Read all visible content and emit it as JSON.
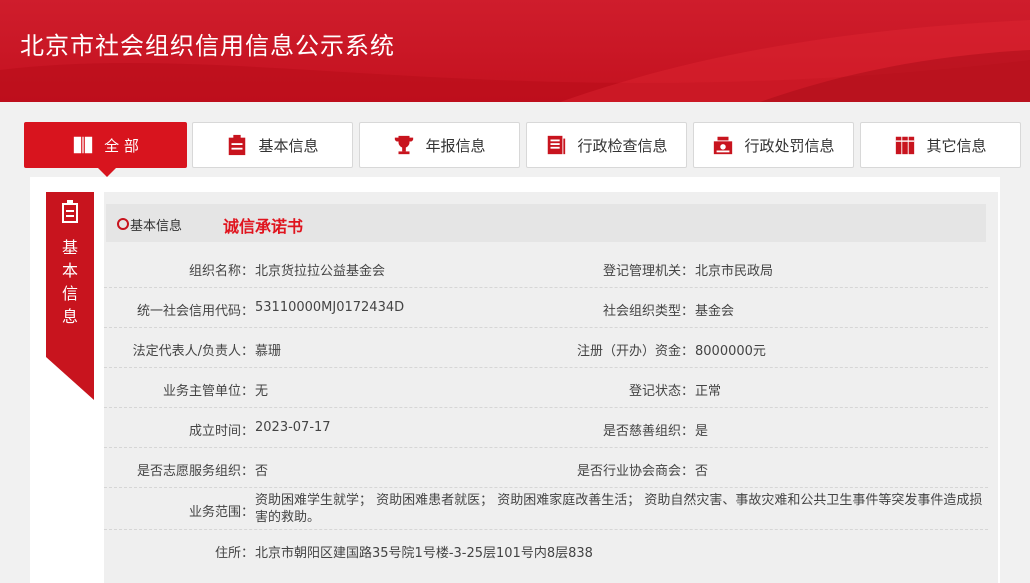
{
  "header": {
    "title": "北京市社会组织信用信息公示系统"
  },
  "tabs": [
    {
      "label": "全 部",
      "icon": "book-icon",
      "active": true
    },
    {
      "label": "基本信息",
      "icon": "clipboard-icon",
      "active": false
    },
    {
      "label": "年报信息",
      "icon": "trophy-icon",
      "active": false
    },
    {
      "label": "行政检查信息",
      "icon": "document-icon",
      "active": false
    },
    {
      "label": "行政处罚信息",
      "icon": "penalty-icon",
      "active": false
    },
    {
      "label": "其它信息",
      "icon": "books-icon",
      "active": false
    }
  ],
  "ribbon": {
    "label": "基\n本\n信\n息"
  },
  "section": {
    "label": "基本信息",
    "promise_link": "诚信承诺书"
  },
  "fields": [
    {
      "k1": "组织名称：",
      "v1": "北京货拉拉公益基金会",
      "k2": "登记管理机关：",
      "v2": "北京市民政局"
    },
    {
      "k1": "统一社会信用代码：",
      "v1": "53110000MJ0172434D",
      "k2": "社会组织类型：",
      "v2": "基金会"
    },
    {
      "k1": "法定代表人/负责人：",
      "v1": "慕珊",
      "k2": "注册（开办）资金：",
      "v2": "8000000元"
    },
    {
      "k1": "业务主管单位：",
      "v1": "无",
      "k2": "登记状态：",
      "v2": "正常"
    },
    {
      "k1": "成立时间：",
      "v1": "2023-07-17",
      "k2": "是否慈善组织：",
      "v2": "是"
    },
    {
      "k1": "是否志愿服务组织：",
      "v1": "否",
      "k2": "是否行业协会商会：",
      "v2": "否"
    }
  ],
  "scope": {
    "k": "业务范围：",
    "v": "资助困难学生就学； 资助困难患者就医； 资助困难家庭改善生活； 资助自然灾害、事故灾难和公共卫生事件等突发事件造成损害的救助。"
  },
  "address": {
    "k": "住所：",
    "v": "北京市朝阳区建国路35号院1号楼-3-25层101号内8层838"
  },
  "colors": {
    "brand_red": "#d8141e",
    "promise_red": "#e0141e"
  }
}
